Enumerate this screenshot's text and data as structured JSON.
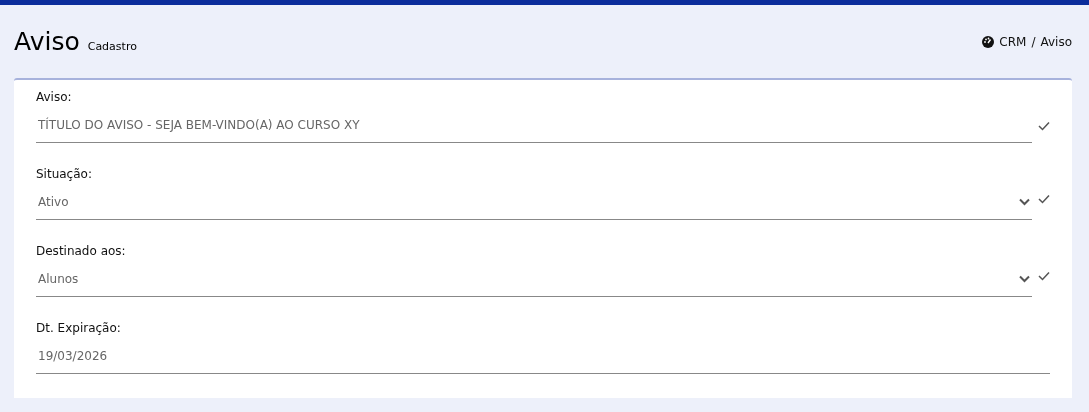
{
  "header": {
    "title": "Aviso",
    "subtitle": "Cadastro",
    "separator": "/",
    "breadcrumb": [
      {
        "label": "CRM",
        "kind": "home"
      },
      {
        "label": "Aviso",
        "kind": "current"
      }
    ]
  },
  "fields": [
    {
      "label": "Aviso:",
      "kind": "text",
      "value": "TÍTULO DO AVISO - SEJA BEM-VINDO(A) AO CURSO XY",
      "valid": true
    },
    {
      "label": "Situação:",
      "kind": "select",
      "value": "Ativo",
      "valid": true
    },
    {
      "label": "Destinado aos:",
      "kind": "select",
      "value": "Alunos",
      "valid": true
    },
    {
      "label": "Dt. Expiração:",
      "kind": "date",
      "value": "19/03/2026",
      "valid": false
    }
  ]
}
